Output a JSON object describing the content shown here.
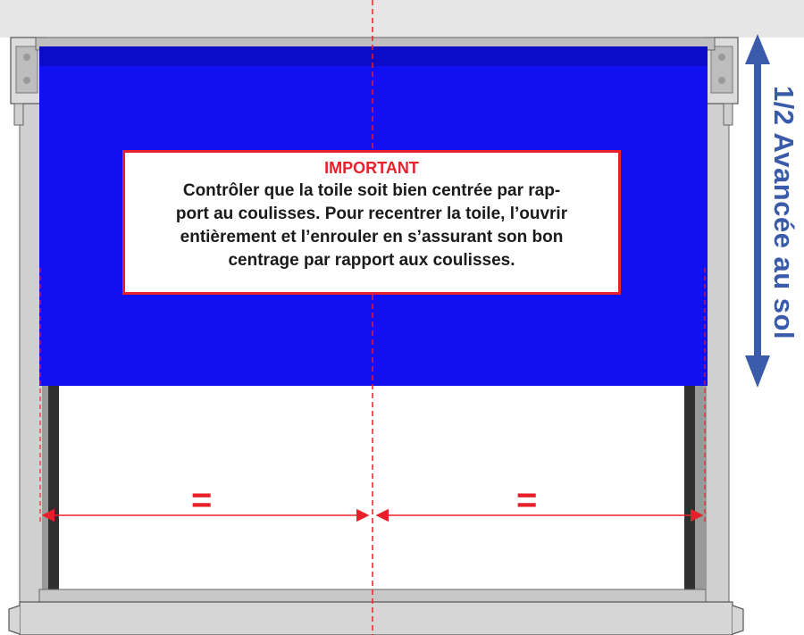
{
  "notice": {
    "title": "IMPORTANT",
    "lines": [
      "Contrôler que la toile soit bien centrée par rap-",
      "port au coulisses. Pour recentrer la toile, l’ouvrir",
      "entièrement et l’enrouler en s’assurant son bon",
      "centrage par rapport aux coulisses."
    ]
  },
  "side_label": "1/2 Avancée au sol",
  "equal_marks": {
    "left": "=",
    "right": "="
  },
  "colors": {
    "fabric": "#1010f0",
    "accent_red": "#e8202a",
    "arrow_blue": "#3a5ba9",
    "frame_gray": "#c8c8c8",
    "ceiling": "#e6e6e6"
  }
}
